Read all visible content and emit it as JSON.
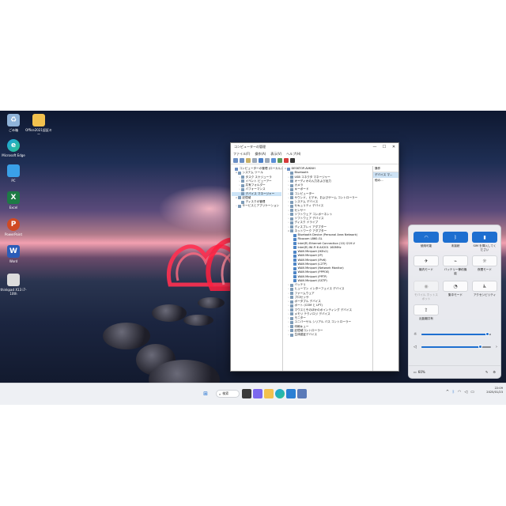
{
  "desktop": {
    "icons": [
      {
        "label": "ごみ箱",
        "icon": "recycle-bin-icon"
      },
      {
        "label": "Office2021認証キー",
        "icon": "folder-icon"
      },
      {
        "label": "Microsoft Edge",
        "icon": "edge-icon"
      },
      {
        "label": "PC",
        "icon": "pc-icon"
      },
      {
        "label": "Excel",
        "icon": "excel-icon"
      },
      {
        "label": "PowerPoint",
        "icon": "powerpoint-icon"
      },
      {
        "label": "Word",
        "icon": "word-icon"
      },
      {
        "label": "thinkpad X13 i7-10th",
        "icon": "laptop-icon"
      }
    ]
  },
  "window": {
    "title": "コンピューターの管理",
    "controls": {
      "minimize": "—",
      "maximize": "☐",
      "close": "✕"
    },
    "menu": [
      "ファイル(F)",
      "操作(A)",
      "表示(V)",
      "ヘルプ(H)"
    ],
    "left_tree": [
      {
        "label": "コンピューターの管理 (ローカル)",
        "level": 0,
        "exp": ""
      },
      {
        "label": "システム ツール",
        "level": 1,
        "exp": "∨"
      },
      {
        "label": "タスク スケジューラ",
        "level": 2,
        "exp": "›"
      },
      {
        "label": "イベント ビューアー",
        "level": 2,
        "exp": "›"
      },
      {
        "label": "共有フォルダー",
        "level": 2,
        "exp": "›"
      },
      {
        "label": "パフォーマンス",
        "level": 2,
        "exp": "›"
      },
      {
        "label": "デバイス マネージャー",
        "level": 2,
        "exp": "",
        "selected": true
      },
      {
        "label": "記憶域",
        "level": 1,
        "exp": "∨"
      },
      {
        "label": "ディスクの管理",
        "level": 2,
        "exp": ""
      },
      {
        "label": "サービスとアプリケーション",
        "level": 1,
        "exp": "›"
      }
    ],
    "device_tree": [
      {
        "label": "DESKTOP-AVKNH",
        "level": 0,
        "exp": "∨"
      },
      {
        "label": "Bluetooth",
        "level": 1,
        "exp": "›"
      },
      {
        "label": "USB コネクタ マネージャー",
        "level": 1,
        "exp": "›"
      },
      {
        "label": "オーディオの入力および出力",
        "level": 1,
        "exp": "›"
      },
      {
        "label": "カメラ",
        "level": 1,
        "exp": "›"
      },
      {
        "label": "キーボード",
        "level": 1,
        "exp": "›"
      },
      {
        "label": "コンピューター",
        "level": 1,
        "exp": "›"
      },
      {
        "label": "サウンド、ビデオ、およびゲーム コントローラー",
        "level": 1,
        "exp": "›"
      },
      {
        "label": "システム デバイス",
        "level": 1,
        "exp": "›"
      },
      {
        "label": "セキュリティ デバイス",
        "level": 1,
        "exp": "›"
      },
      {
        "label": "センサー",
        "level": 1,
        "exp": "›"
      },
      {
        "label": "ソフトウェア コンポーネント",
        "level": 1,
        "exp": "›"
      },
      {
        "label": "ソフトウェア デバイス",
        "level": 1,
        "exp": "›"
      },
      {
        "label": "ディスク ドライブ",
        "level": 1,
        "exp": "›"
      },
      {
        "label": "ディスプレイ アダプター",
        "level": 1,
        "exp": "›"
      },
      {
        "label": "ネットワーク アダプター",
        "level": 1,
        "exp": "∨"
      },
      {
        "label": "Bluetooth Device (Personal Area Network)",
        "level": 2,
        "exp": ""
      },
      {
        "label": "Fibocom L860-GL",
        "level": 2,
        "exp": ""
      },
      {
        "label": "Intel(R) Ethernet Connection (10) I219-V",
        "level": 2,
        "exp": ""
      },
      {
        "label": "Intel(R) Wi-Fi 6 AX201 160MHz",
        "level": 2,
        "exp": ""
      },
      {
        "label": "WAN Miniport (IKEv2)",
        "level": 2,
        "exp": ""
      },
      {
        "label": "WAN Miniport (IP)",
        "level": 2,
        "exp": ""
      },
      {
        "label": "WAN Miniport (IPv6)",
        "level": 2,
        "exp": ""
      },
      {
        "label": "WAN Miniport (L2TP)",
        "level": 2,
        "exp": ""
      },
      {
        "label": "WAN Miniport (Network Monitor)",
        "level": 2,
        "exp": ""
      },
      {
        "label": "WAN Miniport (PPPOE)",
        "level": 2,
        "exp": ""
      },
      {
        "label": "WAN Miniport (PPTP)",
        "level": 2,
        "exp": ""
      },
      {
        "label": "WAN Miniport (SSTP)",
        "level": 2,
        "exp": ""
      },
      {
        "label": "バッテリ",
        "level": 1,
        "exp": "›"
      },
      {
        "label": "ヒューマン インターフェイス デバイス",
        "level": 1,
        "exp": "›"
      },
      {
        "label": "ファームウェア",
        "level": 1,
        "exp": "›"
      },
      {
        "label": "プロセッサ",
        "level": 1,
        "exp": "›"
      },
      {
        "label": "ポータブル デバイス",
        "level": 1,
        "exp": "›"
      },
      {
        "label": "ポート (COM と LPT)",
        "level": 1,
        "exp": "›"
      },
      {
        "label": "マウスとそのほかのポインティング デバイス",
        "level": 1,
        "exp": "›"
      },
      {
        "label": "メモリ テクノロジ デバイス",
        "level": 1,
        "exp": "›"
      },
      {
        "label": "モニター",
        "level": 1,
        "exp": "›"
      },
      {
        "label": "ユニバーサル シリアル バス コントローラー",
        "level": 1,
        "exp": "›"
      },
      {
        "label": "印刷キュー",
        "level": 1,
        "exp": "›"
      },
      {
        "label": "記憶域コントローラー",
        "level": 1,
        "exp": "›"
      },
      {
        "label": "生体認証デバイス",
        "level": 1,
        "exp": "›"
      }
    ],
    "actions": {
      "header": "操作",
      "selected": "デバイス マ...",
      "other": "他の..."
    }
  },
  "quick_settings": {
    "tiles": [
      {
        "label": "使用可能",
        "state": "on",
        "icon": "wifi-icon"
      },
      {
        "label": "未接続",
        "state": "on",
        "icon": "bluetooth-icon"
      },
      {
        "label": "SIM を挿入してください",
        "state": "on",
        "icon": "cellular-icon"
      },
      {
        "label": "機内モード",
        "state": "off",
        "icon": "airplane-icon"
      },
      {
        "label": "バッテリー節約機能",
        "state": "off",
        "icon": "battery-saver-icon"
      },
      {
        "label": "夜間モード",
        "state": "off",
        "icon": "night-light-icon"
      },
      {
        "label": "モバイル ホットスポット",
        "state": "disabled",
        "icon": "hotspot-icon"
      },
      {
        "label": "集中モード",
        "state": "off",
        "icon": "focus-icon"
      },
      {
        "label": "アクセシビリティ",
        "state": "off",
        "icon": "accessibility-icon"
      },
      {
        "label": "近距離共有",
        "state": "off",
        "icon": "nearby-share-icon"
      }
    ],
    "brightness": 0.95,
    "volume": 0.85,
    "battery_text": "60%"
  },
  "taskbar": {
    "search_label": "検索",
    "time": "22:09",
    "date": "2025/01/23"
  },
  "colors": {
    "accent": "#1e6fd0",
    "taskbar_bg": "#eef0f4"
  }
}
